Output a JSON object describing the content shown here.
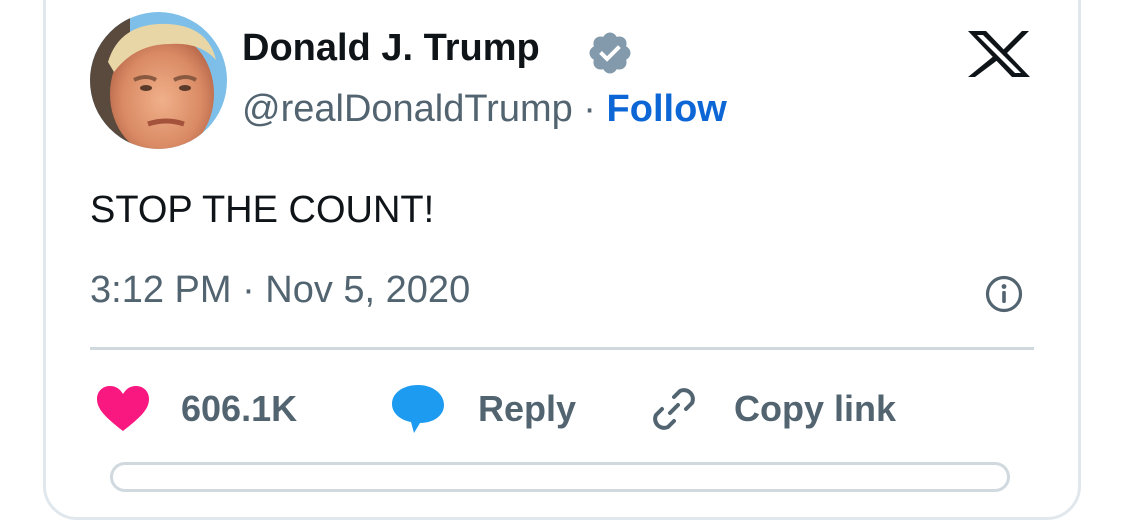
{
  "user": {
    "display_name": "Donald J. Trump",
    "handle": "@realDonaldTrump",
    "separator": " · ",
    "follow_label": "Follow",
    "verified_icon": "verified-badge-icon"
  },
  "tweet": {
    "text": "STOP THE COUNT!",
    "timestamp": "3:12 PM · Nov 5, 2020"
  },
  "actions": {
    "likes_count": "606.1K",
    "reply_label": "Reply",
    "copy_link_label": "Copy link"
  },
  "icons": {
    "brand": "x-logo-icon",
    "info": "info-icon",
    "like": "heart-icon",
    "reply": "speech-bubble-icon",
    "copy": "link-icon"
  },
  "colors": {
    "follow": "#0c66d6",
    "heart": "#f91880",
    "reply_bubble": "#1d9bf0",
    "verified_badge": "#829aab",
    "secondary_text": "#536471",
    "divider": "#cfd9de"
  }
}
